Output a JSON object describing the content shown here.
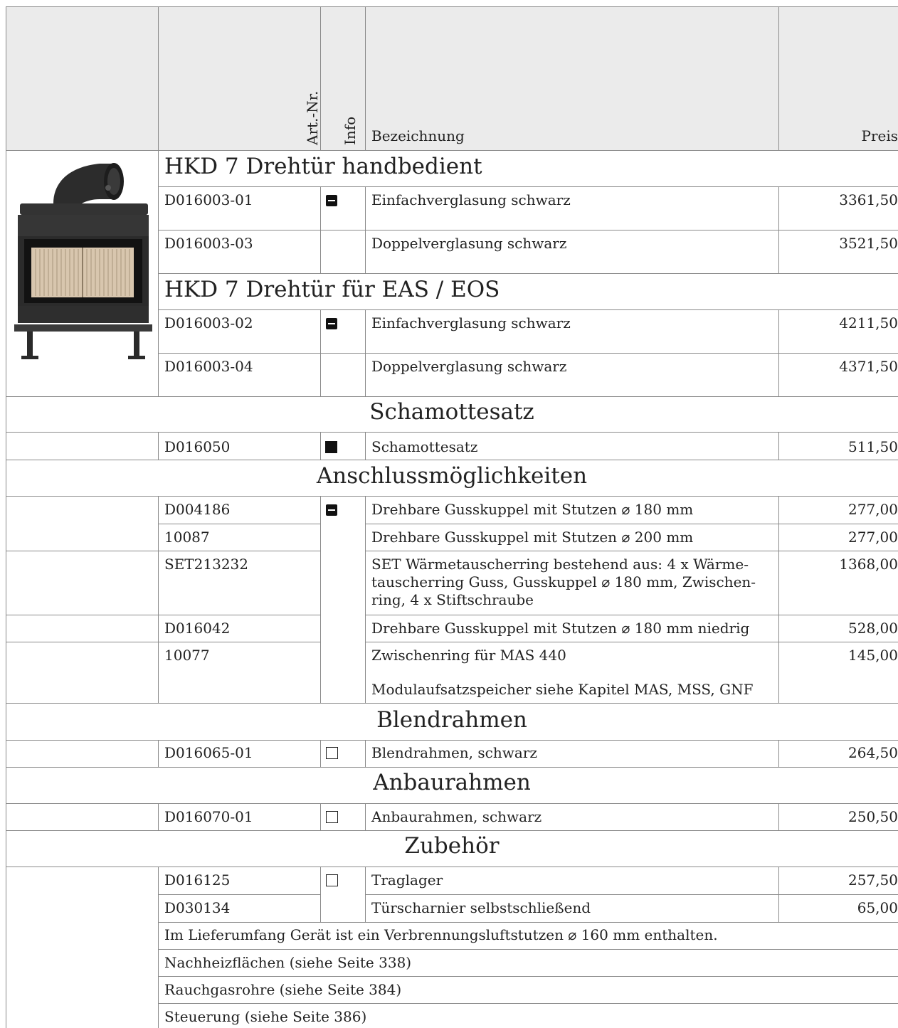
{
  "header": {
    "art_nr": "Art.-Nr.",
    "info": "Info",
    "bezeichnung": "Bezeichnung",
    "preis": "Preis"
  },
  "groups": [
    {
      "title": "HKD 7 Drehtür handbedient",
      "rows": [
        {
          "art": "D016003-01",
          "desc": "Einfachverglasung schwarz",
          "price": "3361,50",
          "icon": "minus-square-icon"
        },
        {
          "art": "D016003-03",
          "desc": "Doppelverglasung schwarz",
          "price": "3521,50"
        }
      ]
    },
    {
      "title": "HKD 7 Drehtür für EAS / EOS",
      "rows": [
        {
          "art": "D016003-02",
          "desc": "Einfachverglasung schwarz",
          "price": "4211,50",
          "icon": "minus-square-icon"
        },
        {
          "art": "D016003-04",
          "desc": "Doppelverglasung schwarz",
          "price": "4371,50"
        }
      ]
    }
  ],
  "sections": [
    {
      "title": "Schamottesatz",
      "rows": [
        {
          "art": "D016050",
          "desc": "Schamottesatz",
          "price": "511,50",
          "icon": "filled-square-icon"
        }
      ]
    },
    {
      "title": "Anschlussmöglichkeiten",
      "rows": [
        {
          "art": "D004186",
          "desc": "Drehbare Gusskuppel mit Stutzen ⌀ 180 mm",
          "price": "277,00",
          "icon": "minus-square-icon"
        },
        {
          "art": "10087",
          "desc": "Drehbare Gusskuppel mit Stutzen ⌀ 200 mm",
          "price": "277,00"
        },
        {
          "art": "SET213232",
          "desc": "SET Wärmetauscherring bestehend aus: 4 x Wärme-\ntauscherring Guss, Gusskuppel ⌀ 180 mm, Zwischen-\nring, 4 x Stiftschraube",
          "price": "1368,00"
        },
        {
          "art": "D016042",
          "desc": "Drehbare Gusskuppel mit Stutzen ⌀ 180 mm niedrig",
          "price": "528,00"
        },
        {
          "art": "10077",
          "desc": "Zwischenring für MAS 440",
          "desc2": "Modulaufsatzspeicher siehe Kapitel MAS, MSS, GNF",
          "price": "145,00"
        }
      ]
    },
    {
      "title": "Blendrahmen",
      "rows": [
        {
          "art": "D016065-01",
          "desc": "Blendrahmen, schwarz",
          "price": "264,50",
          "icon": "empty-square-icon"
        }
      ]
    },
    {
      "title": "Anbaurahmen",
      "rows": [
        {
          "art": "D016070-01",
          "desc": "Anbaurahmen, schwarz",
          "price": "250,50",
          "icon": "empty-square-icon"
        }
      ]
    },
    {
      "title": "Zubehör",
      "rows": [
        {
          "art": "D016125",
          "desc": "Traglager",
          "price": "257,50",
          "icon": "empty-square-icon"
        },
        {
          "art": "D030134",
          "desc": "Türscharnier selbstschließend",
          "price": "65,00"
        }
      ]
    }
  ],
  "notes": [
    "Im Lieferumfang Gerät ist ein Verbrennungsluftstutzen ⌀ 160 mm enthalten.",
    "Nachheizflächen (siehe Seite 338)",
    "Rauchgasrohre (siehe Seite 384)",
    "Steuerung (siehe Seite 386)"
  ],
  "colors": {
    "line": "#8a8a8a",
    "header_bg": "#ebebeb",
    "icon": "#111111"
  }
}
